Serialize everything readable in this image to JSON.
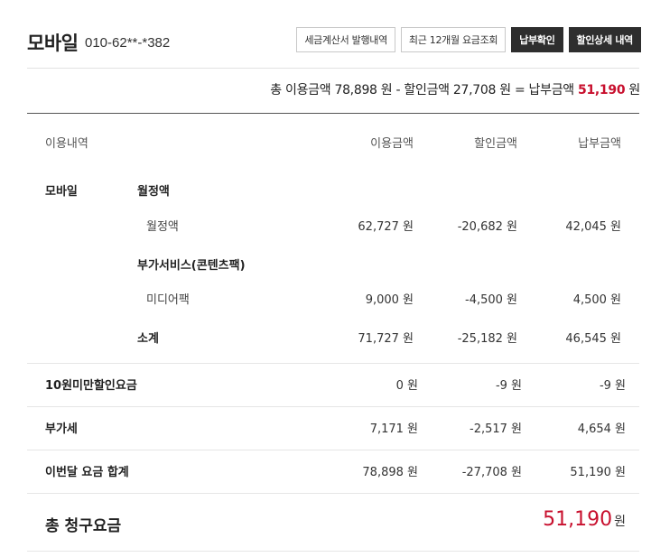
{
  "header": {
    "title": "모바일",
    "phone": "010-62**-*382",
    "buttons": [
      "세금계산서 발행내역",
      "최근 12개월 요금조회",
      "납부확인",
      "할인상세 내역"
    ]
  },
  "summary": {
    "part1": "총 이용금액 78,898 원 - 할인금액 27,708 원 = 납부금액 ",
    "pay_amount": "51,190",
    "pay_unit": " 원"
  },
  "table": {
    "headers": [
      "이용내역",
      "이용금액",
      "할인금액",
      "납부금액"
    ],
    "category": "모바일",
    "groups": [
      {
        "name": "월정액",
        "item": "월정액",
        "usage": "62,727 원",
        "discount": "-20,682 원",
        "payment": "42,045 원"
      },
      {
        "name": "부가서비스(콘텐츠팩)",
        "item": "미디어팩",
        "usage": "9,000 원",
        "discount": "-4,500 원",
        "payment": "4,500 원"
      }
    ],
    "subtotal": {
      "label": "소계",
      "usage": "71,727 원",
      "discount": "-25,182 원",
      "payment": "46,545 원"
    },
    "rows": [
      {
        "label": "10원미만할인요금",
        "usage": "0 원",
        "discount": "-9 원",
        "payment": "-9 원"
      },
      {
        "label": "부가세",
        "usage": "7,171 원",
        "discount": "-2,517 원",
        "payment": "4,654 원"
      },
      {
        "label": "이번달 요금 합계",
        "usage": "78,898 원",
        "discount": "-27,708 원",
        "payment": "51,190 원"
      }
    ]
  },
  "total": {
    "label": "총 청구요금",
    "amount": "51,190",
    "unit": "원"
  },
  "colors": {
    "accent": "#c8102e",
    "dark_button": "#2e2e2e"
  }
}
